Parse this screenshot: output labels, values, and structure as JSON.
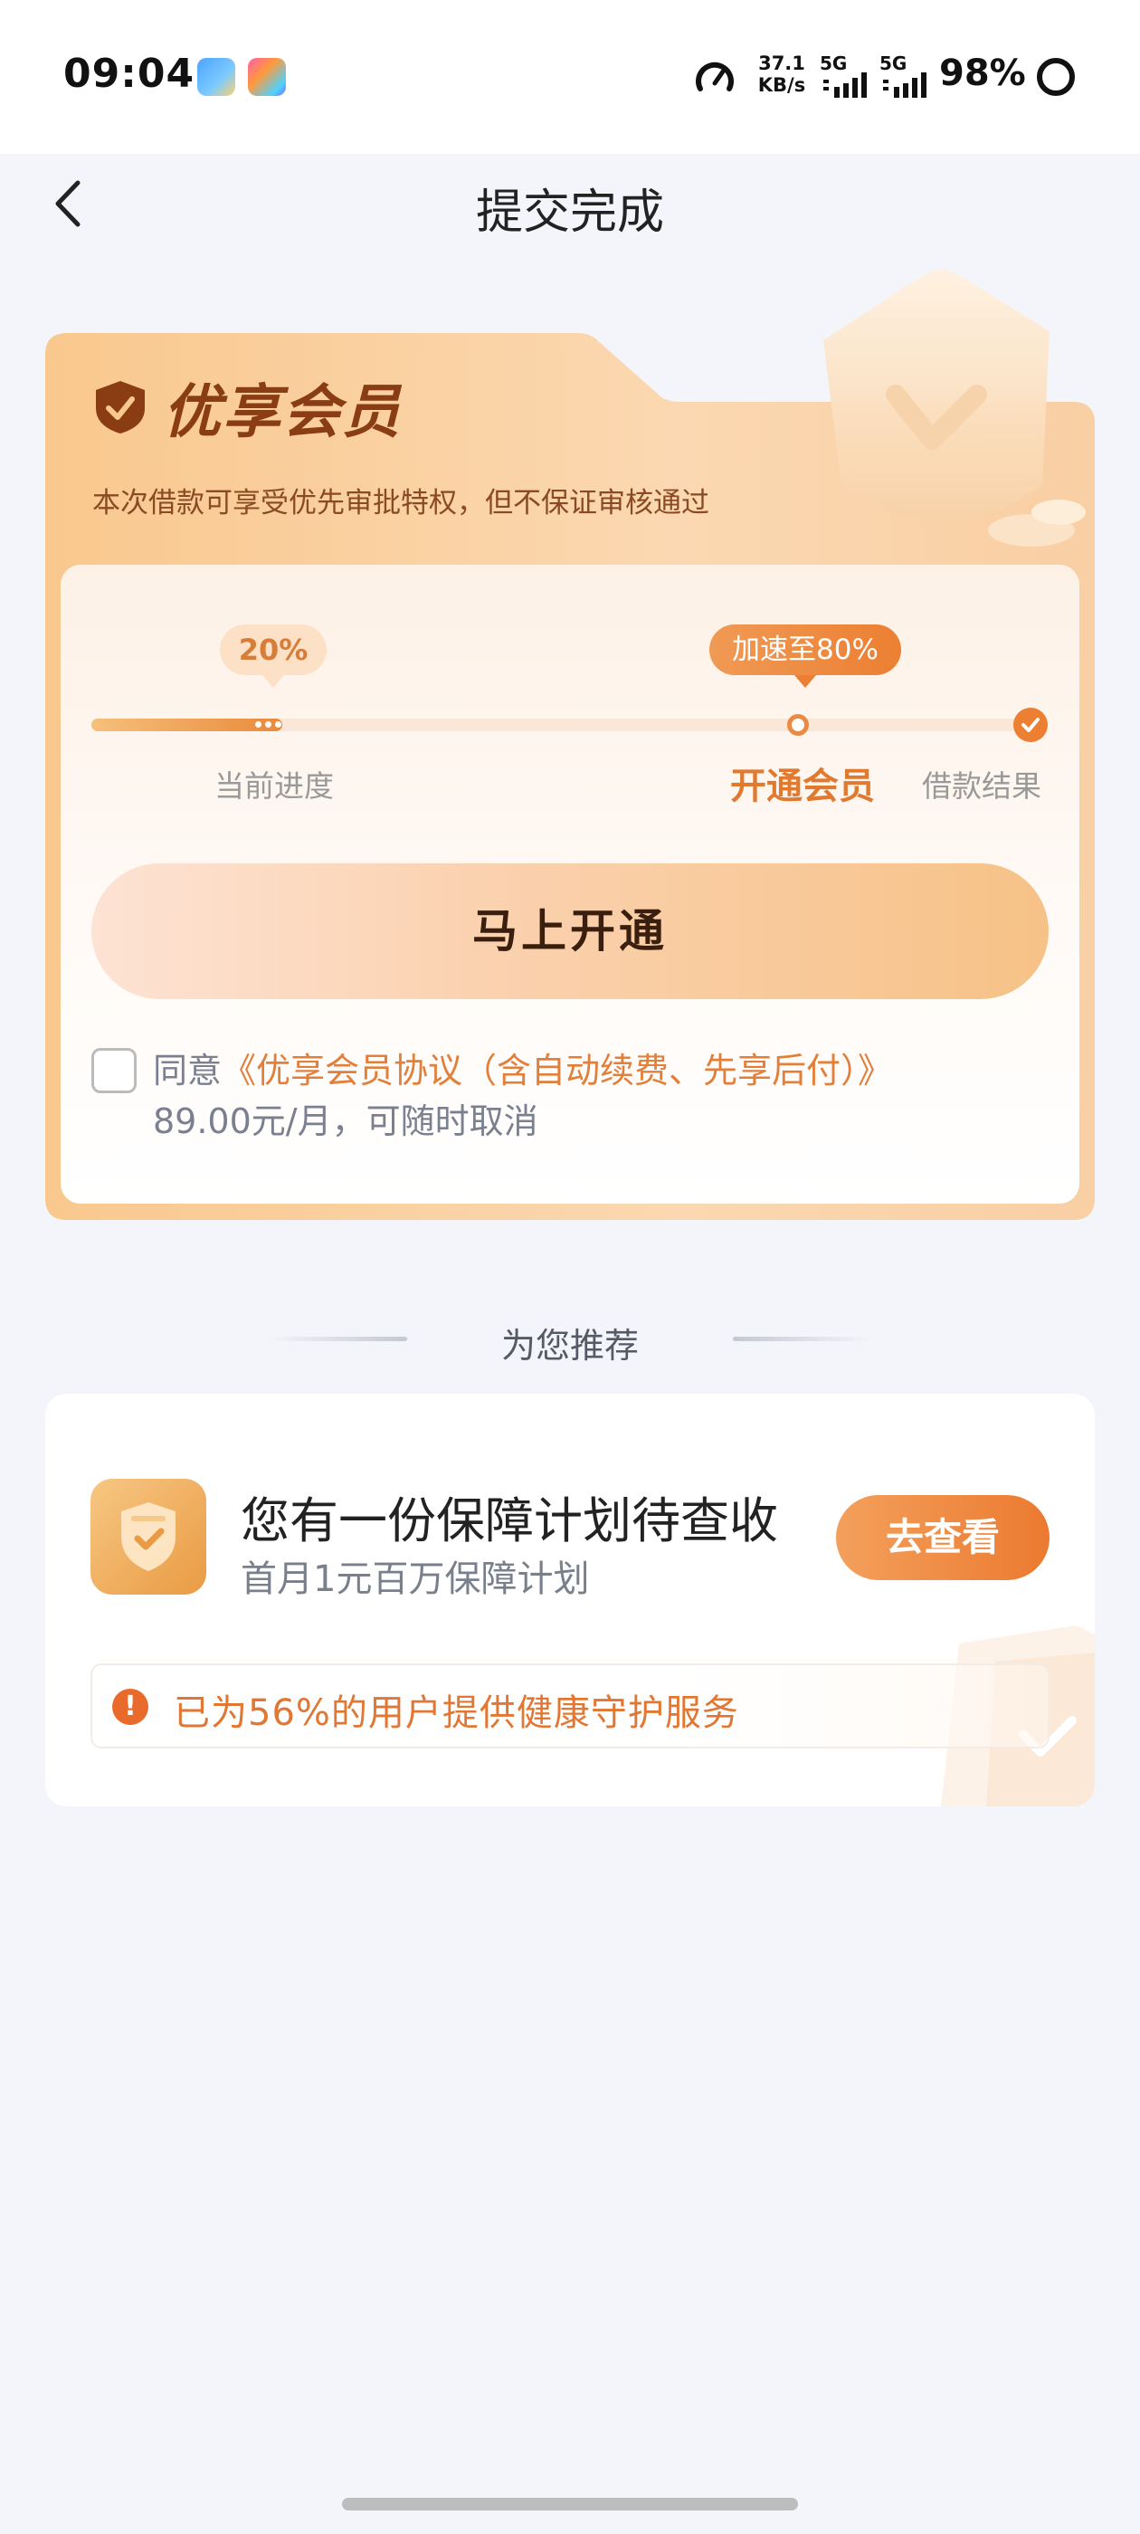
{
  "status_bar": {
    "time": "09:04",
    "net_speed_value": "37.1",
    "net_speed_unit": "KB/s",
    "signal1_label": "5G",
    "signal2_label": "5G",
    "battery": "98%",
    "icons": [
      "app-icon-1",
      "app-icon-2",
      "speedometer-icon",
      "signal-icon",
      "signal-icon",
      "battery-ring-icon"
    ]
  },
  "nav": {
    "title": "提交完成",
    "back_icon": "chevron-left-icon"
  },
  "member_card": {
    "title": "优享会员",
    "subtitle": "本次借款可享受优先审批特权，但不保证审核通过",
    "progress": {
      "current_percent_label": "20%",
      "current_fraction": 0.2,
      "boost_label": "加速至80%",
      "steps": [
        "当前进度",
        "开通会员",
        "借款结果"
      ]
    },
    "open_button": "马上开通",
    "agreement": {
      "prefix": "同意",
      "link_text": "《优享会员协议（含自动续费、先享后付）》",
      "price_text": "89.00元/月，可随时取消"
    },
    "colors": {
      "accent": "#ec7f32",
      "title_brown": "#8a3d12"
    }
  },
  "recommend": {
    "section_title": "为您推荐",
    "card": {
      "title": "您有一份保障计划待查收",
      "subtitle": "首月1元百万保障计划",
      "button": "去查看",
      "notice_icon": "!",
      "notice": "已为56%的用户提供健康守护服务"
    }
  }
}
